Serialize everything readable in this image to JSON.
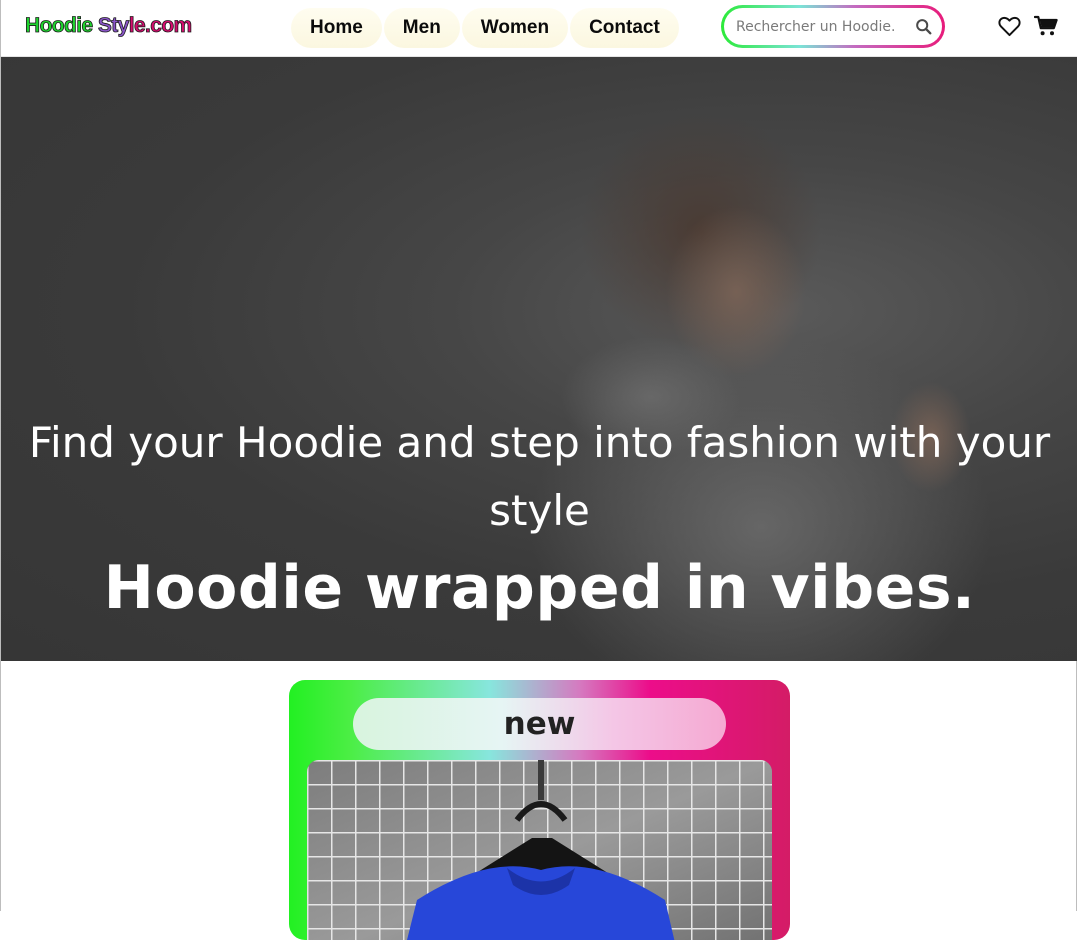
{
  "brand": {
    "logo_part1": "Hoodie",
    "logo_part2": "Sty",
    "logo_part3": "le.com"
  },
  "nav": {
    "items": [
      {
        "label": "Home"
      },
      {
        "label": "Men"
      },
      {
        "label": "Women"
      },
      {
        "label": "Contact"
      }
    ]
  },
  "search": {
    "placeholder": "Rechercher un Hoodie."
  },
  "icons": {
    "search": "search-icon",
    "wishlist": "heart-icon",
    "cart": "cart-icon"
  },
  "hero": {
    "tagline": "Find your Hoodie and step into fashion with your style",
    "headline": "Hoodie wrapped in vibes."
  },
  "product_card": {
    "badge": "new"
  },
  "colors": {
    "accent_green": "#22f022",
    "accent_pink": "#e81b7b",
    "hero_overlay": "#3a3a3a"
  }
}
